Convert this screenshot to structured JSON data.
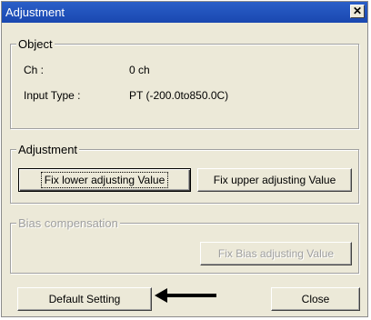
{
  "window": {
    "title": "Adjustment",
    "close_symbol": "✕"
  },
  "object_group": {
    "legend": "Object",
    "ch_label": "Ch :",
    "ch_value": "0 ch",
    "input_type_label": "Input Type :",
    "input_type_value": "PT (-200.0to850.0C)"
  },
  "adjustment_group": {
    "legend": "Adjustment",
    "fix_lower_label": "Fix lower adjusting Value",
    "fix_upper_label": "Fix upper adjusting Value"
  },
  "bias_group": {
    "legend": "Bias compensation",
    "fix_bias_label": "Fix Bias adjusting Value"
  },
  "footer": {
    "default_setting_label": "Default Setting",
    "close_label": "Close"
  },
  "icons": {
    "arrow": "left-arrow-icon"
  },
  "colors": {
    "titlebar": "#1a48b0",
    "window_bg": "#ece9d8",
    "disabled_text": "#a0a0a0"
  }
}
